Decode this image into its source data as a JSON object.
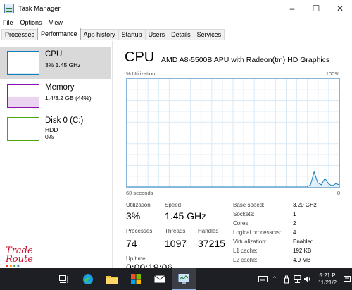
{
  "window": {
    "title": "Task Manager",
    "icon": "task-manager-icon"
  },
  "menu": [
    "File",
    "Options",
    "View"
  ],
  "tabs": [
    {
      "label": "Processes",
      "active": false
    },
    {
      "label": "Performance",
      "active": true
    },
    {
      "label": "App history",
      "active": false
    },
    {
      "label": "Startup",
      "active": false
    },
    {
      "label": "Users",
      "active": false
    },
    {
      "label": "Details",
      "active": false
    },
    {
      "label": "Services",
      "active": false
    }
  ],
  "resources": [
    {
      "name": "CPU",
      "sub1": "3%  1.45 GHz",
      "sub2": "",
      "color": "#117dbb",
      "selected": true
    },
    {
      "name": "Memory",
      "sub1": "1.4/3.2 GB (44%)",
      "sub2": "",
      "color": "#8b12ae",
      "selected": false
    },
    {
      "name": "Disk 0 (C:)",
      "sub1": "HDD",
      "sub2": "0%",
      "color": "#4da60c",
      "selected": false
    }
  ],
  "cpu": {
    "title": "CPU",
    "model": "AMD A8-5500B APU with Radeon(tm) HD Graphics",
    "util_label": "% Utilization",
    "util_max": "100%",
    "axis_left": "60 seconds",
    "axis_right": "0",
    "graph_color": "#117dbb",
    "graph_points": [
      0,
      0,
      0,
      0,
      0,
      0,
      0,
      0,
      0,
      0,
      0,
      0,
      0,
      0,
      0,
      0,
      0,
      0,
      0,
      0,
      0,
      0,
      0,
      0,
      0,
      0,
      0,
      0,
      0,
      0,
      0,
      0,
      0,
      0,
      0,
      0,
      0,
      0,
      0,
      0,
      0,
      0,
      0,
      0,
      0,
      0,
      0,
      0,
      0,
      0,
      0,
      2,
      14,
      4,
      2,
      8,
      3,
      1,
      3,
      2
    ]
  },
  "stats": {
    "utilization_label": "Utilization",
    "utilization": "3%",
    "speed_label": "Speed",
    "speed": "1.45 GHz",
    "processes_label": "Processes",
    "processes": "74",
    "threads_label": "Threads",
    "threads": "1097",
    "handles_label": "Handles",
    "handles": "37215",
    "uptime_label": "Up time",
    "uptime": "0:00:19:06"
  },
  "details": [
    {
      "label": "Base speed:",
      "value": "3.20 GHz"
    },
    {
      "label": "Sockets:",
      "value": "1"
    },
    {
      "label": "Cores:",
      "value": "2"
    },
    {
      "label": "Logical processors:",
      "value": "4"
    },
    {
      "label": "Virtualization:",
      "value": "Enabled"
    },
    {
      "label": "L1 cache:",
      "value": "192 KB"
    },
    {
      "label": "L2 cache:",
      "value": "4.0 MB"
    }
  ],
  "watermark": {
    "line1": "Trade",
    "line2": "Route"
  },
  "taskbar": {
    "clock_time": "5:21 P",
    "clock_date": "11/21/2"
  }
}
